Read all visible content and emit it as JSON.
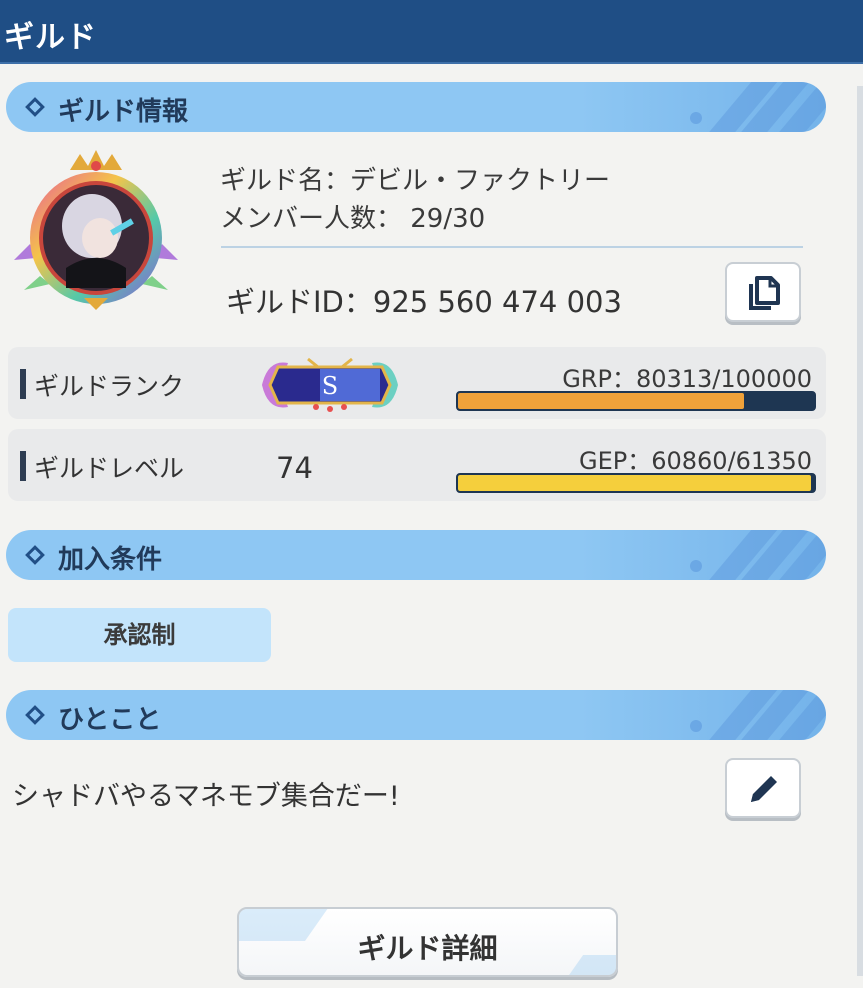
{
  "app": {
    "title": "ギルド"
  },
  "sections": {
    "info": "ギルド情報",
    "conditions": "加入条件",
    "comment": "ひとこと"
  },
  "guild": {
    "name_line": "ギルド名：デビル・ファクトリー",
    "members_line": "メンバー人数： 29/30",
    "id_line": "ギルドID：925 560 474 003"
  },
  "rank": {
    "label": "ギルドランク",
    "badge_letter": "S",
    "gauge_text": "GRP：80313/100000",
    "progress": 0.80313,
    "color": "#f0a23a"
  },
  "level": {
    "label": "ギルドレベル",
    "value": "74",
    "gauge_text": "GEP：60860/61350",
    "progress": 0.992,
    "color": "#f5cf3c"
  },
  "condition": {
    "value": "承認制"
  },
  "comment": {
    "text": "シャドバやるマネモブ集合だー!"
  },
  "buttons": {
    "copy_icon": "copy-icon",
    "edit_icon": "pencil-icon",
    "detail_label": "ギルド詳細"
  },
  "colors": {
    "header_bar": "#1f4e85",
    "section_bar": "#8ec7f3",
    "gauge_track": "#1e3652"
  }
}
